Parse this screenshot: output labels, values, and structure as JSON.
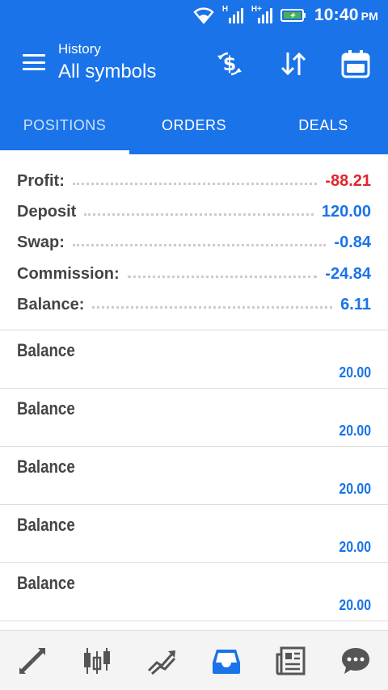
{
  "status_bar": {
    "signal1_label": "H",
    "signal2_label": "H+",
    "time": "10:40",
    "ampm": "PM"
  },
  "header": {
    "subtitle": "History",
    "title": "All symbols"
  },
  "toolbar_icons": [
    "currency-exchange-icon",
    "sort-icon",
    "calendar-icon"
  ],
  "tabs": [
    {
      "label": "POSITIONS",
      "active": true
    },
    {
      "label": "ORDERS",
      "active": false
    },
    {
      "label": "DEALS",
      "active": false
    }
  ],
  "summary": [
    {
      "label": "Profit:",
      "value": "-88.21",
      "color": "#e0262b"
    },
    {
      "label": "Deposit",
      "value": "120.00",
      "color": "#1a73e8"
    },
    {
      "label": "Swap:",
      "value": "-0.84",
      "color": "#1a73e8"
    },
    {
      "label": "Commission:",
      "value": "-24.84",
      "color": "#1a73e8"
    },
    {
      "label": "Balance:",
      "value": "6.11",
      "color": "#1a73e8"
    }
  ],
  "entries": [
    {
      "name": "Balance",
      "amount": "20.00"
    },
    {
      "name": "Balance",
      "amount": "20.00"
    },
    {
      "name": "Balance",
      "amount": "20.00"
    },
    {
      "name": "Balance",
      "amount": "20.00"
    },
    {
      "name": "Balance",
      "amount": "20.00"
    }
  ],
  "bottom_nav": [
    "quotes-icon",
    "chart-icon",
    "trade-icon",
    "history-icon",
    "news-icon",
    "chat-icon"
  ],
  "colors": {
    "accent": "#1a73e8",
    "negative": "#e0262b",
    "nav_inactive": "#555555"
  }
}
